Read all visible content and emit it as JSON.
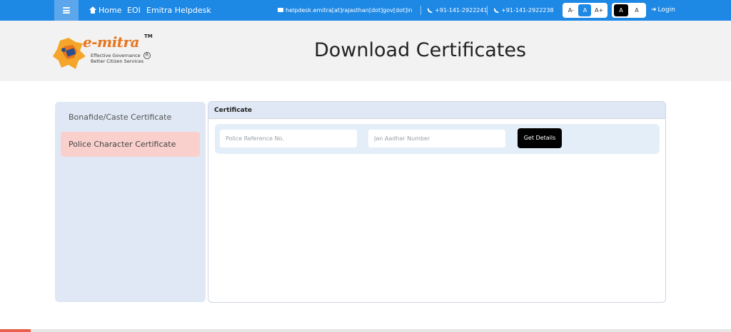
{
  "topbar": {
    "menu_icon": "hamburger-icon",
    "nav": [
      {
        "label": "Home",
        "icon": "home-icon"
      },
      {
        "label": "EOI"
      },
      {
        "label": "Emitra Helpdesk"
      }
    ],
    "email": "helpdesk.emitra[at]rajasthan[dot]gov[dot]in",
    "phone1": "+91-141-2922241",
    "phone2": "+91-141-2922238",
    "font_controls": [
      "A-",
      "A",
      "A+"
    ],
    "active_font": "A",
    "contrast_controls": [
      "A",
      "A"
    ],
    "login_label": "Login",
    "colors": {
      "bar": "#1e88e5",
      "accent": "#e8604c"
    }
  },
  "header": {
    "logo": {
      "title": "e-mitra",
      "tm": "TM",
      "tagline1": "Effective Governance",
      "tagline2": "Better Citizen Services",
      "registered": "R"
    },
    "page_title": "Download Certificates"
  },
  "sidebar": {
    "items": [
      {
        "label": "Bonafide/Caste Certificate",
        "active": false
      },
      {
        "label": "Police Character Certificate",
        "active": true
      }
    ]
  },
  "card": {
    "title": "Certificate",
    "fields": {
      "police_placeholder": "Police Reference No.",
      "police_value": "",
      "jan_placeholder": "Jan Aadhar Number",
      "jan_value": ""
    },
    "button_label": "Get Details"
  }
}
